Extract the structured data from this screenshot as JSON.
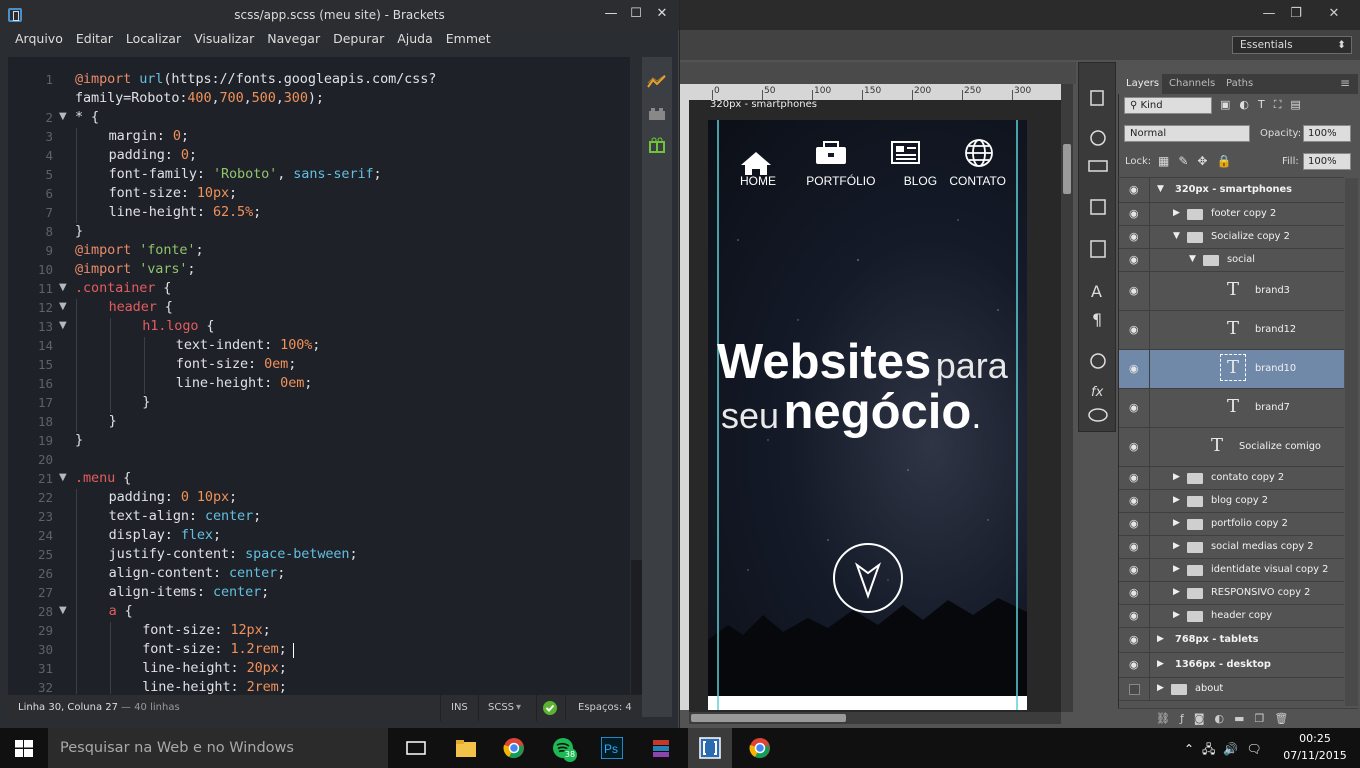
{
  "brackets": {
    "title": "scss/app.scss (meu site) - Brackets",
    "menu": [
      "Arquivo",
      "Editar",
      "Localizar",
      "Visualizar",
      "Navegar",
      "Depurar",
      "Ajuda",
      "Emmet"
    ],
    "lines": [
      {
        "n": "1",
        "t": "@import url(https://fonts.googleapis.com/css?",
        "i": 0
      },
      {
        "n": "",
        "t": "family=Roboto:400,700,500,300);",
        "i": 0
      },
      {
        "n": "2",
        "t": "* {",
        "i": 0,
        "f": true
      },
      {
        "n": "3",
        "t": "margin: 0;",
        "i": 1
      },
      {
        "n": "4",
        "t": "padding: 0;",
        "i": 1
      },
      {
        "n": "5",
        "t": "font-family: 'Roboto', sans-serif;",
        "i": 1
      },
      {
        "n": "6",
        "t": "font-size: 10px;",
        "i": 1
      },
      {
        "n": "7",
        "t": "line-height: 62.5%;",
        "i": 1
      },
      {
        "n": "8",
        "t": "}",
        "i": 0
      },
      {
        "n": "9",
        "t": "@import 'fonte';",
        "i": 0
      },
      {
        "n": "10",
        "t": "@import 'vars';",
        "i": 0
      },
      {
        "n": "11",
        "t": ".container {",
        "i": 0,
        "f": true
      },
      {
        "n": "12",
        "t": "header {",
        "i": 1,
        "f": true
      },
      {
        "n": "13",
        "t": "h1.logo {",
        "i": 2,
        "f": true
      },
      {
        "n": "14",
        "t": "text-indent: 100%;",
        "i": 3
      },
      {
        "n": "15",
        "t": "font-size: 0em;",
        "i": 3
      },
      {
        "n": "16",
        "t": "line-height: 0em;",
        "i": 3
      },
      {
        "n": "17",
        "t": "}",
        "i": 2
      },
      {
        "n": "18",
        "t": "}",
        "i": 1
      },
      {
        "n": "19",
        "t": "}",
        "i": 0
      },
      {
        "n": "20",
        "t": "",
        "i": 0
      },
      {
        "n": "21",
        "t": ".menu {",
        "i": 0,
        "f": true
      },
      {
        "n": "22",
        "t": "padding: 0 10px;",
        "i": 1
      },
      {
        "n": "23",
        "t": "text-align: center;",
        "i": 1
      },
      {
        "n": "24",
        "t": "display: flex;",
        "i": 1
      },
      {
        "n": "25",
        "t": "justify-content: space-between;",
        "i": 1
      },
      {
        "n": "26",
        "t": "align-content: center;",
        "i": 1
      },
      {
        "n": "27",
        "t": "align-items: center;",
        "i": 1
      },
      {
        "n": "28",
        "t": "a {",
        "i": 1,
        "f": true
      },
      {
        "n": "29",
        "t": "font-size: 12px;",
        "i": 2
      },
      {
        "n": "30",
        "t": "font-size: 1.2rem;",
        "i": 2
      },
      {
        "n": "31",
        "t": "line-height: 20px;",
        "i": 2
      },
      {
        "n": "32",
        "t": "line-height: 2rem;",
        "i": 2
      }
    ],
    "status": {
      "position": "Linha 30, Coluna 27",
      "lines": "— 40 linhas",
      "ins": "INS",
      "lang": "SCSS",
      "spaces": "Espaços: 4"
    }
  },
  "photoshop": {
    "workspace": "Essentials",
    "ruler": [
      "0",
      "50",
      "100",
      "150",
      "200",
      "250",
      "300"
    ],
    "artboard_label": "320px - smartphones",
    "site": {
      "nav": [
        "HOME",
        "PORTFÓLIO",
        "BLOG",
        "CONTATO"
      ],
      "hero_bold1": "Websites",
      "hero_light1": "para",
      "hero_light2": "seu",
      "hero_bold2": "negócio",
      "hero_dot": "."
    },
    "tabs": [
      "Layers",
      "Channels",
      "Paths"
    ],
    "kind": "Kind",
    "blend": "Normal",
    "opacity_label": "Opacity:",
    "opacity": "100%",
    "lock_label": "Lock:",
    "fill_label": "Fill:",
    "fill": "100%",
    "layers": [
      {
        "name": "320px - smartphones",
        "type": "group",
        "level": 0,
        "open": true,
        "bold": true
      },
      {
        "name": "footer copy 2",
        "type": "folder",
        "level": 1,
        "open": false
      },
      {
        "name": "Socialize copy 2",
        "type": "folder",
        "level": 1,
        "open": true
      },
      {
        "name": "social",
        "type": "folder",
        "level": 2,
        "open": true
      },
      {
        "name": "brand3",
        "type": "text",
        "level": 3
      },
      {
        "name": "brand12",
        "type": "text",
        "level": 3
      },
      {
        "name": "brand10",
        "type": "text",
        "level": 3,
        "selected": true
      },
      {
        "name": "brand7",
        "type": "text",
        "level": 3
      },
      {
        "name": "Socialize comigo",
        "type": "text",
        "level": 2
      },
      {
        "name": "contato copy 2",
        "type": "folder",
        "level": 1,
        "open": false
      },
      {
        "name": "blog copy 2",
        "type": "folder",
        "level": 1,
        "open": false
      },
      {
        "name": "portfolio copy 2",
        "type": "folder",
        "level": 1,
        "open": false
      },
      {
        "name": "social medias copy 2",
        "type": "folder",
        "level": 1,
        "open": false
      },
      {
        "name": "identidate visual copy 2",
        "type": "folder",
        "level": 1,
        "open": false
      },
      {
        "name": "RESPONSIVO copy 2",
        "type": "folder",
        "level": 1,
        "open": false
      },
      {
        "name": "header copy",
        "type": "folder",
        "level": 1,
        "open": false
      },
      {
        "name": "768px - tablets",
        "type": "group",
        "level": 0,
        "open": false,
        "bold": true
      },
      {
        "name": "1366px - desktop",
        "type": "group",
        "level": 0,
        "open": false,
        "bold": true
      },
      {
        "name": "about",
        "type": "folder",
        "level": 0,
        "open": false,
        "hidden": true
      }
    ]
  },
  "taskbar": {
    "search_placeholder": "Pesquisar na Web e no Windows",
    "time": "00:25",
    "date": "07/11/2015",
    "spotify_badge": "38"
  }
}
